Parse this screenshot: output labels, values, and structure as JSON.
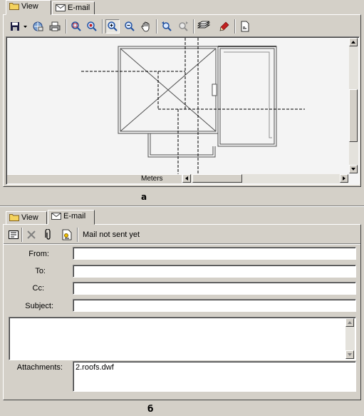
{
  "top": {
    "tabs": [
      {
        "label": "View",
        "active": true
      },
      {
        "label": "E-mail",
        "active": false
      }
    ],
    "toolbar": {
      "icons": [
        "save-icon",
        "dropdown-arrow-icon",
        "publish-icon",
        "print-icon",
        "zoom-window-icon",
        "zoom-extents-icon",
        "zoom-in-icon",
        "zoom-out-icon",
        "pan-hand-icon",
        "previous-view-icon",
        "next-view-icon",
        "layers-icon",
        "markup-pen-icon",
        "properties-icon"
      ]
    },
    "status_label": "Meters",
    "caption": "a"
  },
  "bottom": {
    "tabs": [
      {
        "label": "View",
        "active": false
      },
      {
        "label": "E-mail",
        "active": true
      }
    ],
    "toolbar": {
      "icons": [
        "address-book-icon",
        "delete-icon",
        "attach-icon",
        "send-icon"
      ],
      "status": "Mail not sent yet"
    },
    "form": {
      "from_label": "From:",
      "from_value": "",
      "to_label": "To:",
      "to_value": "",
      "cc_label": "Cc:",
      "cc_value": "",
      "subject_label": "Subject:",
      "subject_value": "",
      "body_value": "",
      "attachments_label": "Attachments:",
      "attachments_value": "2.roofs.dwf"
    },
    "caption": "б"
  }
}
